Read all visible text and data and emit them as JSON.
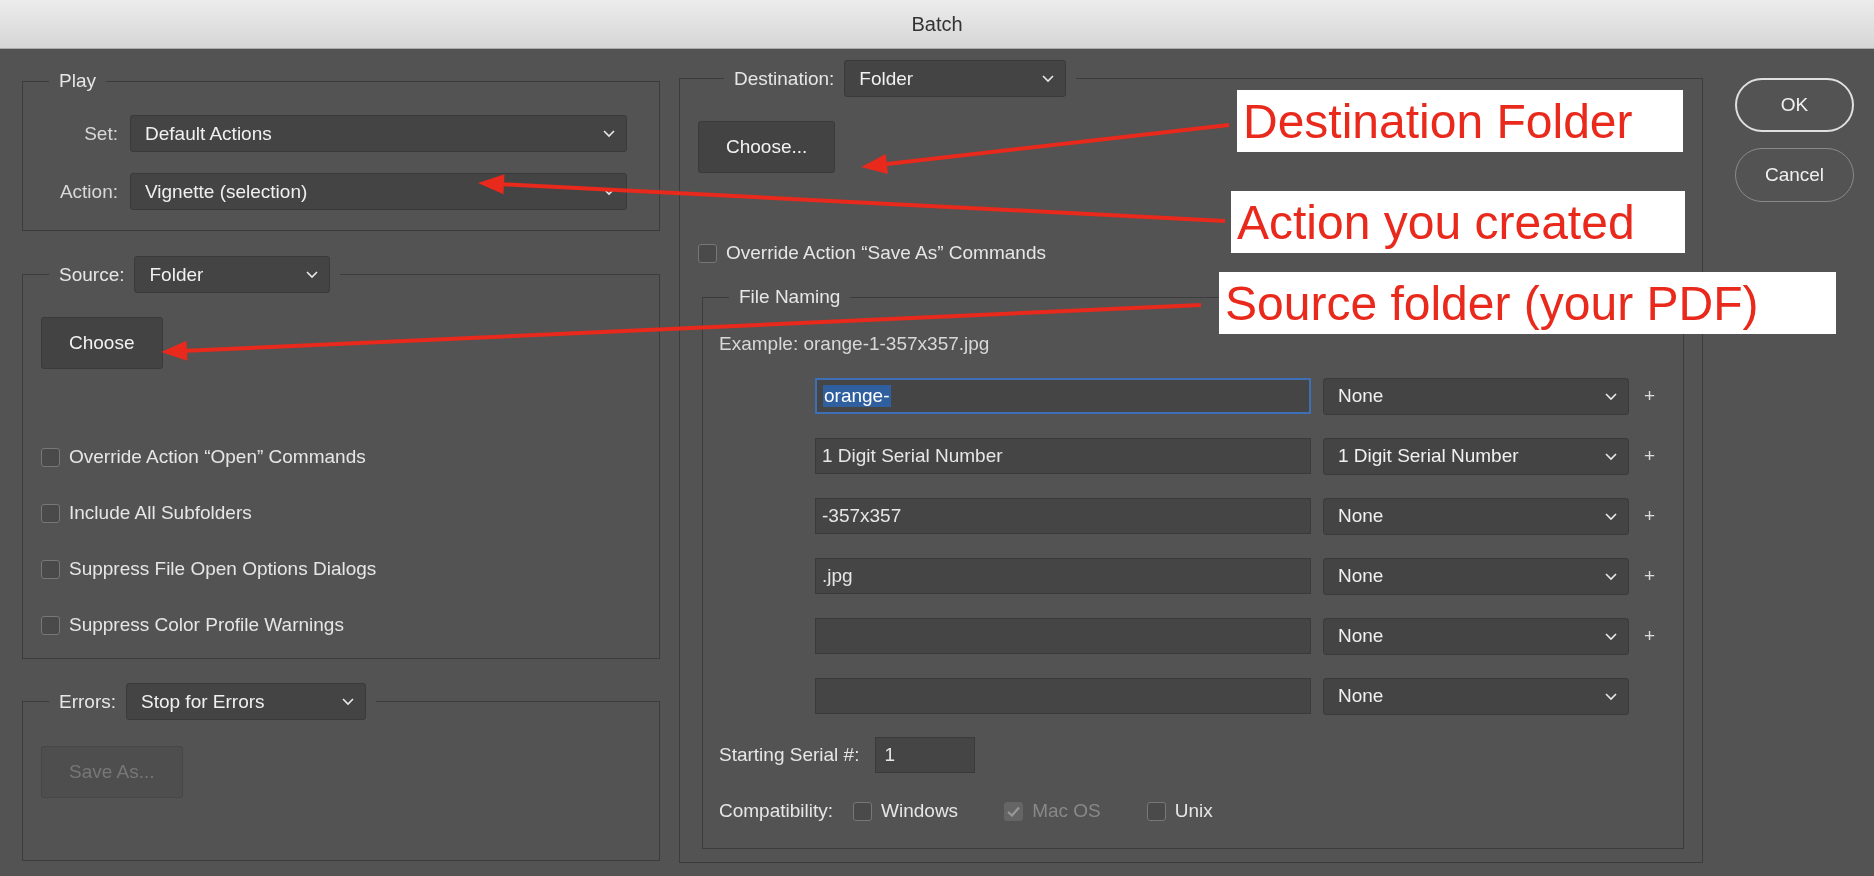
{
  "window": {
    "title": "Batch"
  },
  "play": {
    "legend": "Play",
    "set": {
      "label": "Set:",
      "value": "Default Actions"
    },
    "action": {
      "label": "Action:",
      "value": "Vignette (selection)"
    }
  },
  "source": {
    "label": "Source:",
    "value": "Folder",
    "choose_button": "Choose",
    "options": [
      {
        "label": "Override Action “Open” Commands",
        "checked": false
      },
      {
        "label": "Include All Subfolders",
        "checked": false
      },
      {
        "label": "Suppress File Open Options Dialogs",
        "checked": false
      },
      {
        "label": "Suppress Color Profile Warnings",
        "checked": false
      }
    ]
  },
  "errors": {
    "label": "Errors:",
    "value": "Stop for Errors",
    "save_button": {
      "label": "Save As...",
      "disabled": true
    }
  },
  "destination": {
    "label": "Destination:",
    "value": "Folder",
    "choose_button": "Choose...",
    "override": {
      "label": "Override Action “Save As” Commands",
      "checked": false
    }
  },
  "file_naming": {
    "legend": "File Naming",
    "example": "Example: orange-1-357x357.jpg",
    "rows": [
      {
        "text": "orange-",
        "focused": true,
        "selection": "None",
        "add": "+"
      },
      {
        "text": "1 Digit Serial Number",
        "focused": false,
        "selection": "1 Digit Serial Number",
        "add": "+"
      },
      {
        "text": "-357x357",
        "focused": false,
        "selection": "None",
        "add": "+"
      },
      {
        "text": ".jpg",
        "focused": false,
        "selection": "None",
        "add": "+"
      },
      {
        "focused": false,
        "selection": "None",
        "add": "+"
      },
      {
        "focused": false,
        "selection": "None"
      }
    ],
    "starting_serial": {
      "label": "Starting Serial #:",
      "value": "1"
    },
    "compatibility": {
      "label": "Compatibility:",
      "options": [
        {
          "label": "Windows",
          "checked": false,
          "disabled": false
        },
        {
          "label": "Mac OS",
          "checked": true,
          "disabled": true
        },
        {
          "label": "Unix",
          "checked": false,
          "disabled": false
        }
      ]
    }
  },
  "buttons": [
    {
      "label": "OK",
      "default": true
    },
    {
      "label": "Cancel",
      "default": false
    }
  ],
  "annotations": [
    {
      "text": "Destination Folder"
    },
    {
      "text": "Action you created"
    },
    {
      "text": "Source folder (your PDF)"
    }
  ]
}
